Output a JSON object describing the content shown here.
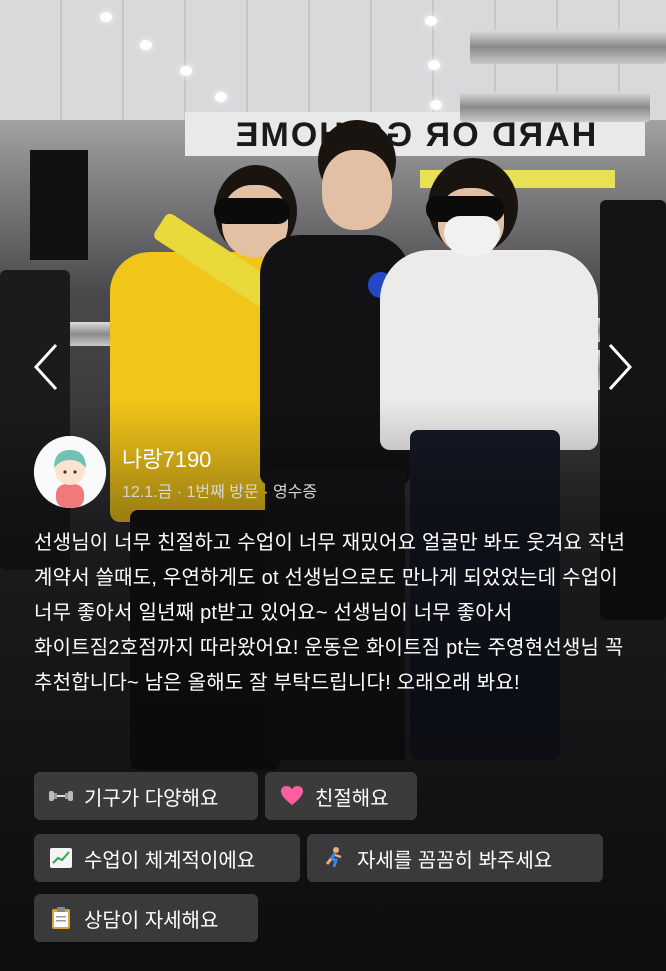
{
  "banner_text": "HARD OR GO HOME",
  "carousel": {
    "prev_icon": "chevron-left-icon",
    "next_icon": "chevron-right-icon"
  },
  "reviewer": {
    "name": "나랑7190",
    "meta": "12.1.금 · 1번째 방문 · 영수증"
  },
  "review_text": "선생님이 너무 친절하고 수업이 너무 재밌어요 얼굴만 봐도 웃겨요 작년 계약서 쓸때도, 우연하게도 ot 선생님으로도 만나게 되었었는데 수업이 너무 좋아서 일년째 pt받고 있어요~ 선생님이 너무 좋아서 화이트짐2호점까지 따라왔어요! 운동은 화이트짐 pt는 주영현선생님 꼭 추천합니다~ 남은 올해도 잘 부탁드립니다! 오래오래 봐요!",
  "tags": [
    {
      "label": "기구가 다양해요",
      "icon": "dumbbell-icon"
    },
    {
      "label": "친절해요",
      "icon": "heart-icon"
    },
    {
      "label": "수업이 체계적이에요",
      "icon": "chart-icon"
    },
    {
      "label": "자세를 꼼꼼히 봐주세요",
      "icon": "runner-icon"
    },
    {
      "label": "상담이 자세해요",
      "icon": "clipboard-icon"
    }
  ],
  "colors": {
    "tag_bg": "#464648",
    "text": "#ffffff",
    "meta": "#d6d6d6",
    "accent_yellow": "#f0c419"
  }
}
